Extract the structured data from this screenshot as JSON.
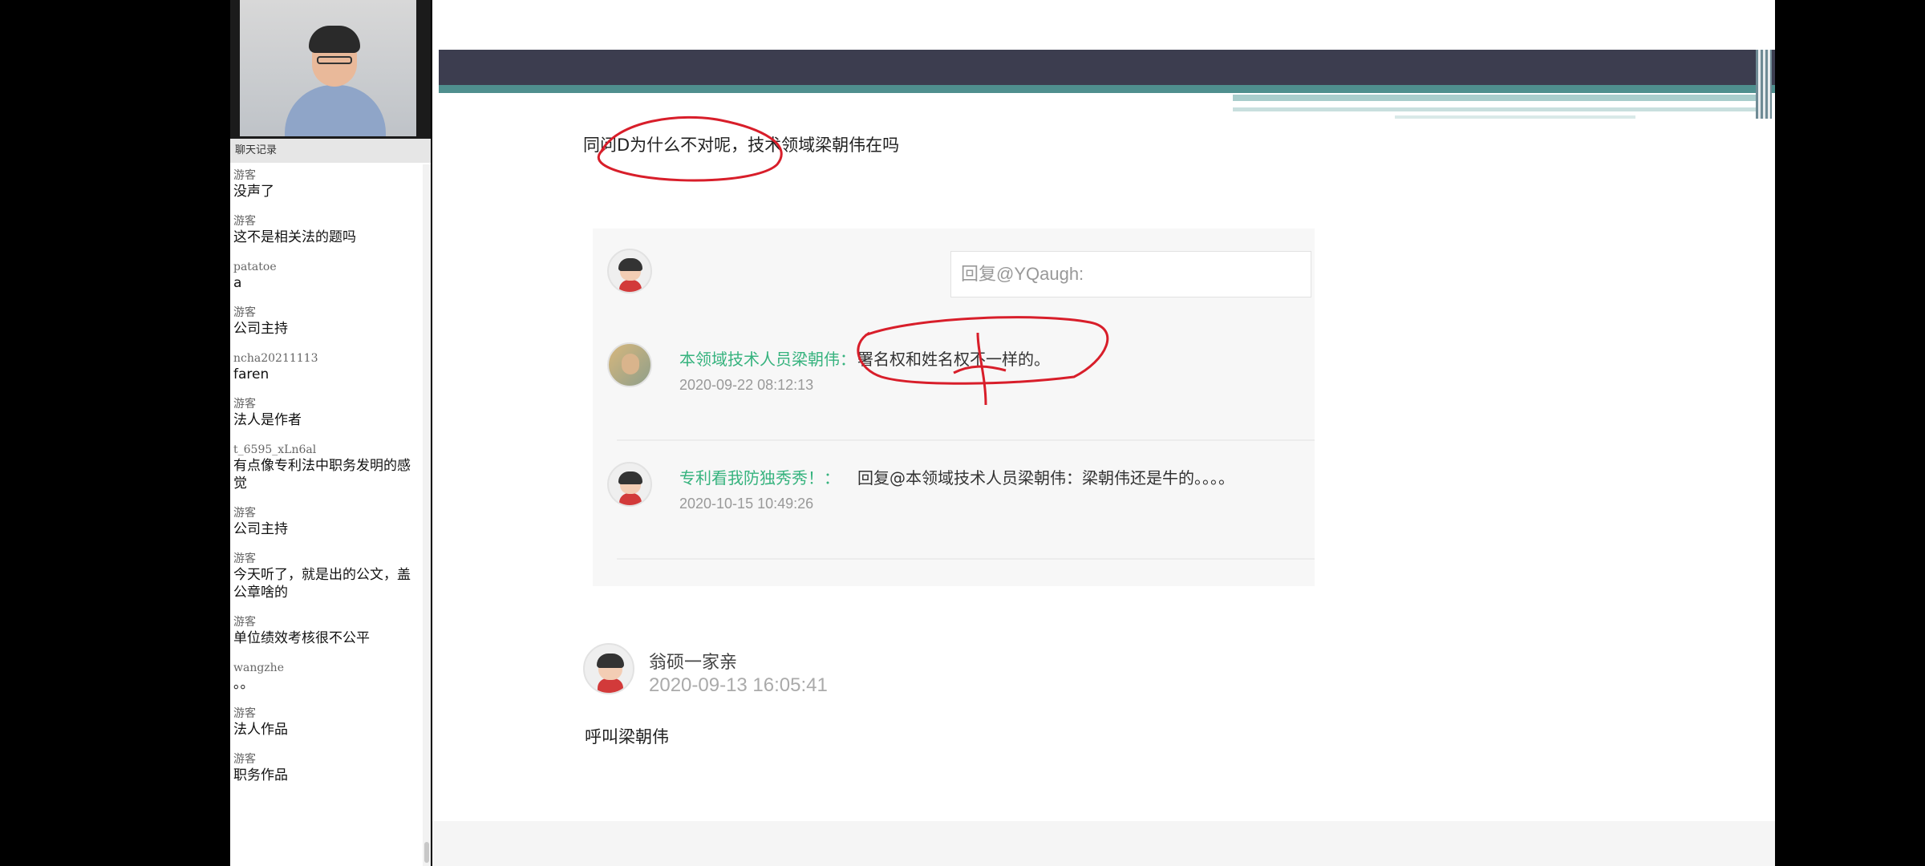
{
  "chat": {
    "header": "聊天记录",
    "messages": [
      {
        "user": "游客",
        "text": "没声了"
      },
      {
        "user": "游客",
        "text": "这不是相关法的题吗"
      },
      {
        "user": "patatoe",
        "text": "a"
      },
      {
        "user": "游客",
        "text": "公司主持"
      },
      {
        "user": "ncha20211113",
        "text": "faren"
      },
      {
        "user": "游客",
        "text": "法人是作者"
      },
      {
        "user": "t_6595_xLn6al",
        "text": "有点像专利法中职务发明的感觉"
      },
      {
        "user": "游客",
        "text": "公司主持"
      },
      {
        "user": "游客",
        "text": "今天听了，就是出的公文，盖公章啥的"
      },
      {
        "user": "游客",
        "text": "单位绩效考核很不公平"
      },
      {
        "user": "wangzhe",
        "text": "。。"
      },
      {
        "user": "游客",
        "text": "法人作品"
      },
      {
        "user": "游客",
        "text": "职务作品"
      }
    ]
  },
  "slide": {
    "question": "同问D为什么不对呢，技术领域梁朝伟在吗",
    "reply_placeholder": "回复@YQaugh:",
    "comments": [
      {
        "user": "本领域技术人员梁朝伟：",
        "text": "署名权和姓名权不一样的。",
        "time": "2020-09-22 08:12:13",
        "avatar": "photo-avatar"
      },
      {
        "user": "专利看我防独秀秀！：",
        "text": "回复@本领域技术人员梁朝伟：梁朝伟还是牛的。。。。",
        "time": "2020-10-15 10:49:26",
        "avatar": "default-avatar"
      }
    ],
    "main_post": {
      "user": "翁硕一家亲",
      "time": "2020-09-13 16:05:41",
      "text": "呼叫梁朝伟"
    }
  },
  "colors": {
    "username_green": "#36b37e",
    "annotation_red": "#d81e2a",
    "header_dark": "#3c3d4f",
    "header_teal": "#4f8f8e"
  }
}
